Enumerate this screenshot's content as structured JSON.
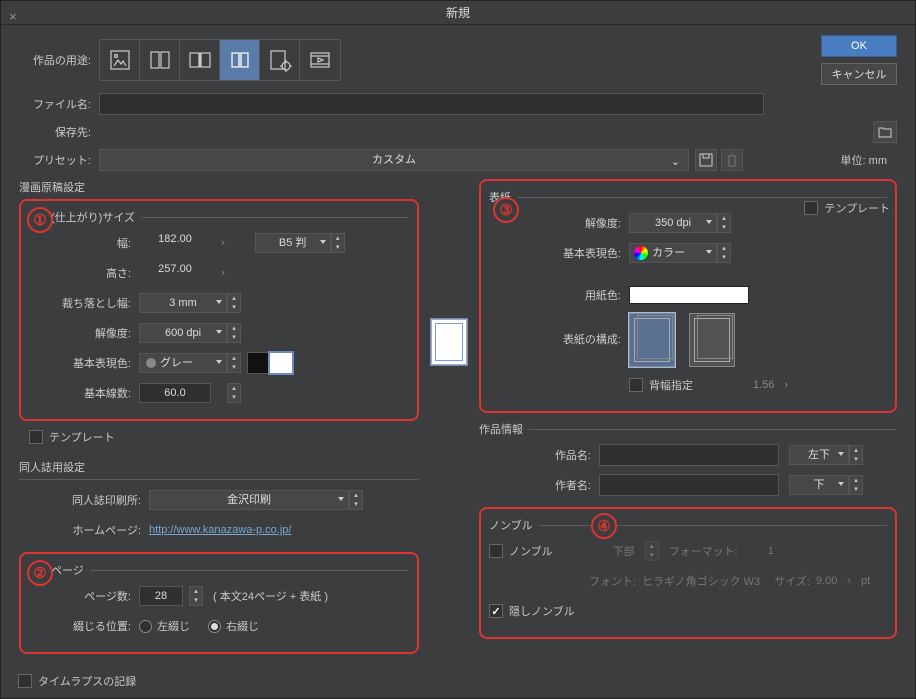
{
  "title": "新規",
  "buttons": {
    "ok": "OK",
    "cancel": "キャンセル"
  },
  "labels": {
    "purpose": "作品の用途:",
    "filename": "ファイル名:",
    "saveto": "保存先:",
    "preset": "プリセット:",
    "unit": "単位:",
    "unit_val": "mm"
  },
  "preset_value": "カスタム",
  "manga": {
    "section": "漫画原稿設定",
    "group": "製本(仕上がり)サイズ",
    "width_l": "幅:",
    "width_v": "182.00",
    "height_l": "高さ:",
    "height_v": "257.00",
    "size_preset": "B5 判",
    "bleed_l": "裁ち落とし幅:",
    "bleed_v": "3 mm",
    "res_l": "解像度:",
    "res_v": "600 dpi",
    "color_l": "基本表現色:",
    "color_v": "グレー",
    "lines_l": "基本線数:",
    "lines_v": "60.0",
    "template": "テンプレート"
  },
  "doujin": {
    "section": "同人誌用設定",
    "printer_l": "同人誌印刷所:",
    "printer_v": "金沢印刷",
    "hp_l": "ホームページ:",
    "hp_url": "http://www.kanazawa-p.co.jp/"
  },
  "pages": {
    "section": "複数ページ",
    "count_l": "ページ数:",
    "count_v": "28",
    "note": "( 本文24ページ + 表紙 )",
    "bind_l": "綴じる位置:",
    "left": "左綴じ",
    "right": "右綴じ"
  },
  "cover": {
    "section": "表紙",
    "res_l": "解像度:",
    "res_v": "350 dpi",
    "color_l": "基本表現色:",
    "color_v": "カラー",
    "paper_l": "用紙色:",
    "struct_l": "表紙の構成:",
    "spine_l": "背幅指定",
    "spine_v": "1.56",
    "template": "テンプレート"
  },
  "work": {
    "section": "作品情報",
    "name_l": "作品名:",
    "pos1": "左下",
    "author_l": "作者名:",
    "pos2": "下"
  },
  "nombre": {
    "section": "ノンブル",
    "nombre": "ノンブル",
    "pos": "下部",
    "fmt_l": "フォーマット:",
    "fmt_v": "1",
    "font_l": "フォント:",
    "font_v": "ヒラギノ角ゴシック W3",
    "size_l": "サイズ:",
    "size_v": "9.00",
    "pt": "pt",
    "hidden": "隠しノンブル"
  },
  "timelapse": "タイムラプスの記録"
}
